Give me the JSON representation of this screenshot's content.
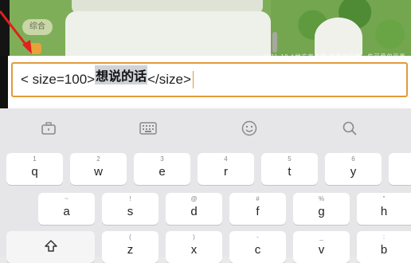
{
  "scene": {
    "chip_label": "综合",
    "blurred_caption": "2021.10  A地方宣传图  某某地区的一些可爱的风景"
  },
  "input": {
    "tag_open": "< size=100>",
    "selected_text": "想说的话",
    "tag_close": "</size>"
  },
  "keyboard": {
    "toolbar": [
      "suitcase-icon",
      "keyboard-icon",
      "emoji-icon",
      "search-icon"
    ],
    "rows": [
      [
        {
          "main": "q",
          "alt": "1"
        },
        {
          "main": "w",
          "alt": "2"
        },
        {
          "main": "e",
          "alt": "3"
        },
        {
          "main": "r",
          "alt": "4"
        },
        {
          "main": "t",
          "alt": "5"
        },
        {
          "main": "y",
          "alt": "6"
        },
        {
          "main": "",
          "alt": ""
        }
      ],
      [
        {
          "main": "a",
          "alt": "~"
        },
        {
          "main": "s",
          "alt": "!"
        },
        {
          "main": "d",
          "alt": "@"
        },
        {
          "main": "f",
          "alt": "#"
        },
        {
          "main": "g",
          "alt": "%"
        },
        {
          "main": "h",
          "alt": "\""
        }
      ],
      [
        {
          "main": "z",
          "alt": "("
        },
        {
          "main": "x",
          "alt": ")"
        },
        {
          "main": "c",
          "alt": "-"
        },
        {
          "main": "v",
          "alt": "_"
        },
        {
          "main": "b",
          "alt": ":"
        }
      ]
    ]
  }
}
